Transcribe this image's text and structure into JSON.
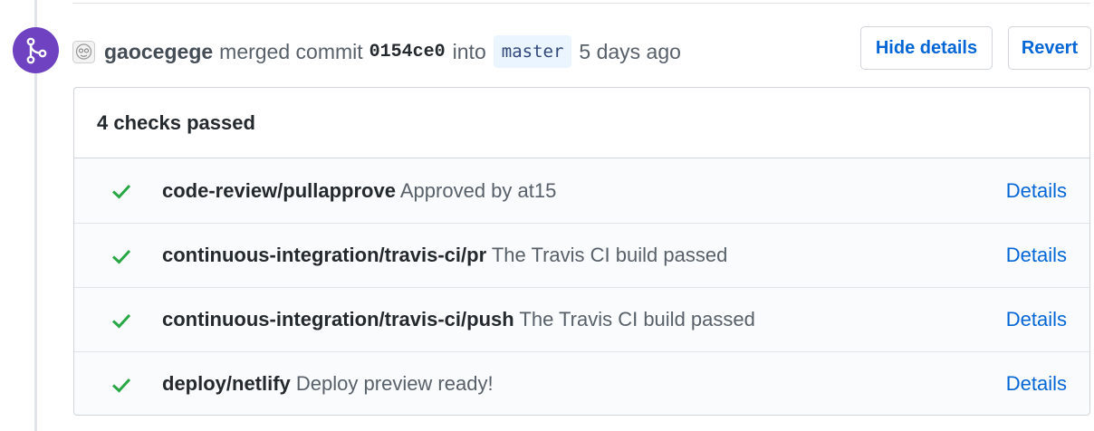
{
  "event": {
    "author": "gaocegege",
    "action": "merged commit",
    "commit_sha": "0154ce0",
    "into_text": "into",
    "branch": "master",
    "time_ago": "5 days ago",
    "badge_icon": "git-merge-icon",
    "badge_color": "#6f42c1"
  },
  "actions": {
    "hide_details_label": "Hide details",
    "revert_label": "Revert"
  },
  "checks": {
    "summary": "4 checks passed",
    "status_color": "#28a745",
    "items": [
      {
        "context": "code-review/pullapprove",
        "description": "Approved by at15",
        "link": "Details"
      },
      {
        "context": "continuous-integration/travis-ci/pr",
        "description": "The Travis CI build passed",
        "link": "Details"
      },
      {
        "context": "continuous-integration/travis-ci/push",
        "description": "The Travis CI build passed",
        "link": "Details"
      },
      {
        "context": "deploy/netlify",
        "description": "Deploy preview ready!",
        "link": "Details"
      }
    ]
  }
}
